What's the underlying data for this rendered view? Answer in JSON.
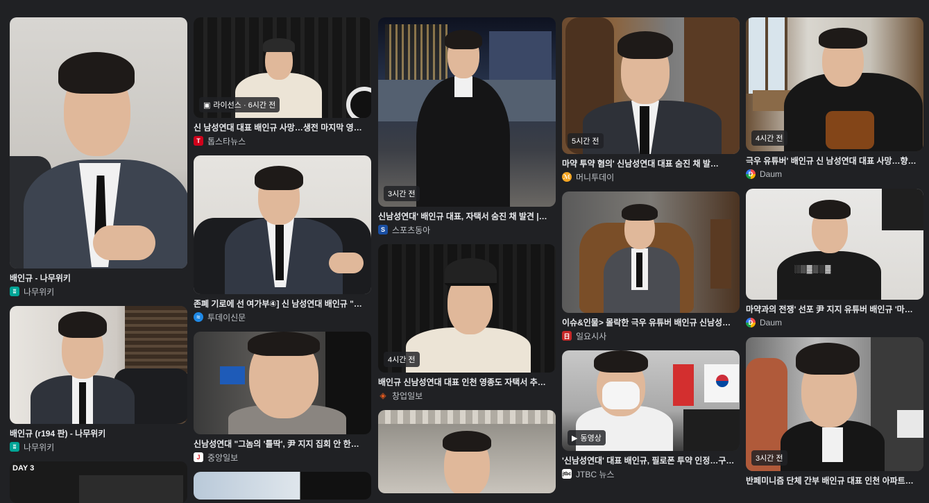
{
  "colors": {
    "background": "#202124",
    "text": "#e8eaed",
    "subtext": "#bdc1c6"
  },
  "columns": [
    [
      {
        "title": "배인규 - 나무위키",
        "source": "나무위키",
        "favicon": "namu",
        "badge": ""
      },
      {
        "title": "배인규 (r194 판) - 나무위키",
        "source": "나무위키",
        "favicon": "namu",
        "badge": ""
      },
      {
        "title": "",
        "source": "",
        "favicon": "",
        "badge": "",
        "overlay": "DAY 3"
      }
    ],
    [
      {
        "title": "신 남성연대 대표 배인규 사망…생전 마지막 영…",
        "source": "톱스타뉴스",
        "favicon": "topstar",
        "badge": "라이선스 · 6시간 전",
        "badge_icon": "image-icon"
      },
      {
        "title": "존폐 기로에 선 여가부④] 신 남성연대 배인규 \"…",
        "source": "투데이신문",
        "favicon": "today",
        "badge": ""
      },
      {
        "title": "신남성연대 \"그놈의 '틀딱', 尹 지지 집회 안 한…",
        "source": "중앙일보",
        "favicon": "joongang",
        "badge": ""
      },
      {
        "title": "",
        "source": "",
        "favicon": "",
        "badge": ""
      }
    ],
    [
      {
        "title": "신남성연대' 배인규 대표, 자택서 숨진 채 발견 |…",
        "source": "스포츠동아",
        "favicon": "sportsdonga",
        "badge": "3시간 전"
      },
      {
        "title": "배인규 신남성연대 대표 인천 영종도 자택서 추…",
        "source": "창업일보",
        "favicon": "changup",
        "badge": "4시간 전"
      },
      {
        "title": "",
        "source": "",
        "favicon": "",
        "badge": ""
      }
    ],
    [
      {
        "title": "마약 투약 혐의' 신남성연대 대표 숨진 채 발…",
        "source": "머니투데이",
        "favicon": "mt",
        "badge": "5시간 전"
      },
      {
        "title": "이슈&인물> 몰락한 극우 유튜버 배인규 신남성…",
        "source": "일요시사",
        "favicon": "ilyo",
        "badge": ""
      },
      {
        "title": "'신남성연대' 대표 배인규, 필로폰 투약 인정…구…",
        "source": "JTBC 뉴스",
        "favicon": "jtbc",
        "badge": "동영상",
        "badge_icon": "play-icon"
      },
      {
        "title": "",
        "source": "",
        "favicon": "",
        "badge": ""
      }
    ],
    [
      {
        "title": "극우 유튜버' 배인규 신 남성연대 대표 사망…향…",
        "source": "Daum",
        "favicon": "daum",
        "badge": "4시간 전"
      },
      {
        "title": "마약과의 전쟁' 선포 尹 지지 유튜버 배인규 '마…",
        "source": "Daum",
        "favicon": "daum",
        "badge": ""
      },
      {
        "title": "반페미니즘 단체 간부 배인규 대표 인천 아파트…",
        "source": "",
        "favicon": "",
        "badge": "3시간 전"
      }
    ]
  ]
}
